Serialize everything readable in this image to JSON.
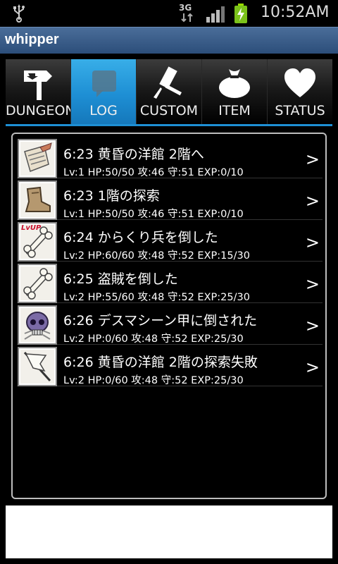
{
  "status_bar": {
    "network": "3G",
    "time": "10:52AM"
  },
  "app": {
    "title": "whipper"
  },
  "tabs": [
    {
      "label": "DUNGEON",
      "icon": "signpost-icon",
      "active": false
    },
    {
      "label": "LOG",
      "icon": "speech-bubble-icon",
      "active": true
    },
    {
      "label": "CUSTOM",
      "icon": "hammer-icon",
      "active": false
    },
    {
      "label": "ITEM",
      "icon": "bag-icon",
      "active": false
    },
    {
      "label": "STATUS",
      "icon": "heart-icon",
      "active": false
    }
  ],
  "log": [
    {
      "title": "6:23 黄昏の洋館 2階へ",
      "stats": "Lv:1 HP:50/50 攻:46 守:51 EXP:0/10",
      "icon": "map-scroll-icon"
    },
    {
      "title": "6:23 1階の探索",
      "stats": "Lv:1 HP:50/50 攻:46 守:51 EXP:0/10",
      "icon": "boot-icon"
    },
    {
      "title": "6:24 からくり兵を倒した",
      "stats": "Lv:2 HP:60/60 攻:48 守:52 EXP:15/30",
      "icon": "bone-icon",
      "badge": "LvUP"
    },
    {
      "title": "6:25 盗賊を倒した",
      "stats": "Lv:2 HP:55/60 攻:48 守:52 EXP:25/30",
      "icon": "bone-icon"
    },
    {
      "title": "6:26 デスマシーン甲に倒された",
      "stats": "Lv:2 HP:0/60 攻:48 守:52 EXP:25/30",
      "icon": "skull-icon"
    },
    {
      "title": "6:26 黄昏の洋館 2階の探索失敗",
      "stats": "Lv:2 HP:0/60 攻:48 守:52 EXP:25/30",
      "icon": "white-flag-icon"
    }
  ],
  "chevron": ">",
  "colors": {
    "title_bar": "#3a5d8a",
    "active_tab": "#1e8fd4",
    "lvup_badge": "#c8102e"
  }
}
